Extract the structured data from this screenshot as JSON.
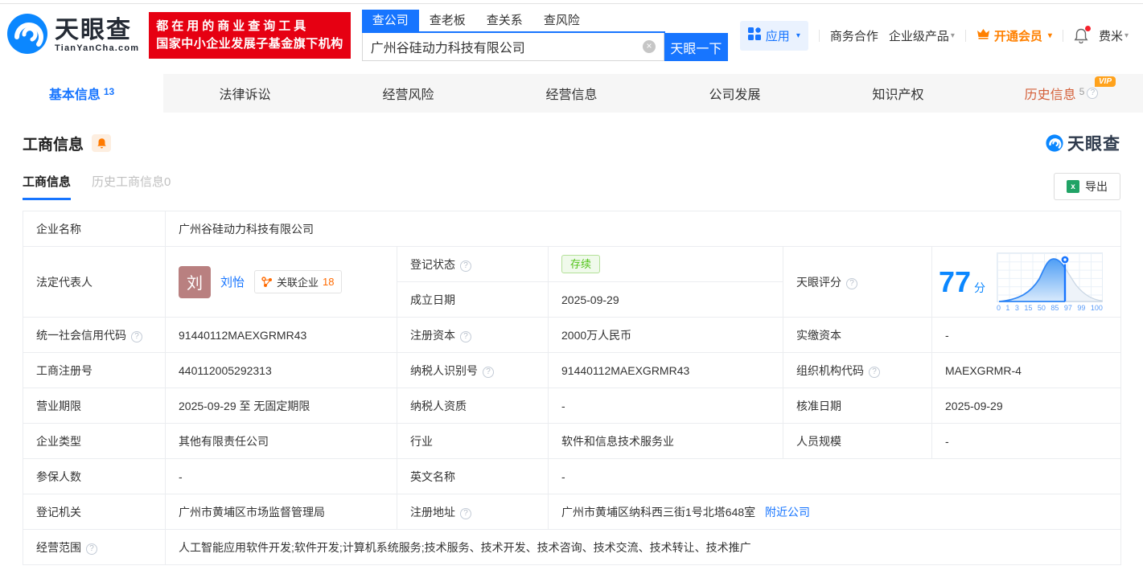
{
  "header": {
    "logo": {
      "cn": "天眼查",
      "en": "TianYanCha.com"
    },
    "banner": {
      "line1": "都在用的商业查询工具",
      "line2": "国家中小企业发展子基金旗下机构"
    },
    "search": {
      "tabs": [
        {
          "label": "查公司"
        },
        {
          "label": "查老板"
        },
        {
          "label": "查关系"
        },
        {
          "label": "查风险"
        }
      ],
      "value": "广州谷硅动力科技有限公司",
      "button": "天眼一下",
      "clear_icon": "close-circle"
    },
    "nav": {
      "apps": "应用",
      "cooperation": "商务合作",
      "enterprise": "企业级产品",
      "vip": "开通会员",
      "user": "费米"
    }
  },
  "main_tabs": [
    {
      "label": "基本信息",
      "count": "13"
    },
    {
      "label": "法律诉讼"
    },
    {
      "label": "经营风险"
    },
    {
      "label": "经营信息"
    },
    {
      "label": "公司发展"
    },
    {
      "label": "知识产权"
    },
    {
      "label": "历史信息",
      "count": "5",
      "vip_badge": "VIP"
    }
  ],
  "section": {
    "title": "工商信息",
    "subtabs": [
      {
        "label": "工商信息"
      },
      {
        "label": "历史工商信息0"
      }
    ],
    "export_label": "导出",
    "watermark": "天眼查"
  },
  "biz": {
    "company_name": {
      "label": "企业名称",
      "value": "广州谷硅动力科技有限公司"
    },
    "legal_rep": {
      "label": "法定代表人",
      "avatar_char": "刘",
      "name": "刘怡",
      "related_label": "关联企业",
      "related_count": "18"
    },
    "reg_status": {
      "label": "登记状态",
      "value": "存续"
    },
    "est_date": {
      "label": "成立日期",
      "value": "2025-09-29"
    },
    "tyc_score": {
      "label": "天眼评分",
      "score": "77",
      "unit": "分",
      "axis": [
        "0",
        "1",
        "3",
        "15",
        "50",
        "85",
        "97",
        "99",
        "100"
      ]
    },
    "credit_code": {
      "label": "统一社会信用代码",
      "value": "91440112MAEXGRMR43"
    },
    "reg_capital": {
      "label": "注册资本",
      "value": "2000万人民币"
    },
    "paid_capital": {
      "label": "实缴资本",
      "value": "-"
    },
    "reg_number": {
      "label": "工商注册号",
      "value": "440112005292313"
    },
    "taxpayer_id": {
      "label": "纳税人识别号",
      "value": "91440112MAEXGRMR43"
    },
    "org_code": {
      "label": "组织机构代码",
      "value": "MAEXGRMR-4"
    },
    "biz_term": {
      "label": "营业期限",
      "value": "2025-09-29 至 无固定期限"
    },
    "taxpayer_qualification": {
      "label": "纳税人资质",
      "value": "-"
    },
    "approval_date": {
      "label": "核准日期",
      "value": "2025-09-29"
    },
    "company_type": {
      "label": "企业类型",
      "value": "其他有限责任公司"
    },
    "industry": {
      "label": "行业",
      "value": "软件和信息技术服务业"
    },
    "staff_size": {
      "label": "人员规模",
      "value": "-"
    },
    "insured_count": {
      "label": "参保人数",
      "value": "-"
    },
    "english_name": {
      "label": "英文名称",
      "value": "-"
    },
    "reg_authority": {
      "label": "登记机关",
      "value": "广州市黄埔区市场监督管理局"
    },
    "reg_address": {
      "label": "注册地址",
      "value": "广州市黄埔区纳科西三街1号北塔648室",
      "nearby_link": "附近公司"
    },
    "business_scope": {
      "label": "经营范围",
      "value": "人工智能应用软件开发;软件开发;计算机系统服务;技术服务、技术开发、技术咨询、技术交流、技术转让、技术推广"
    }
  },
  "colors": {
    "brand_blue": "#1775ff",
    "score_blue": "#0b87ff",
    "vip_orange": "#ff8000",
    "status_green": "#52c41a",
    "banner_red": "#e60012"
  }
}
